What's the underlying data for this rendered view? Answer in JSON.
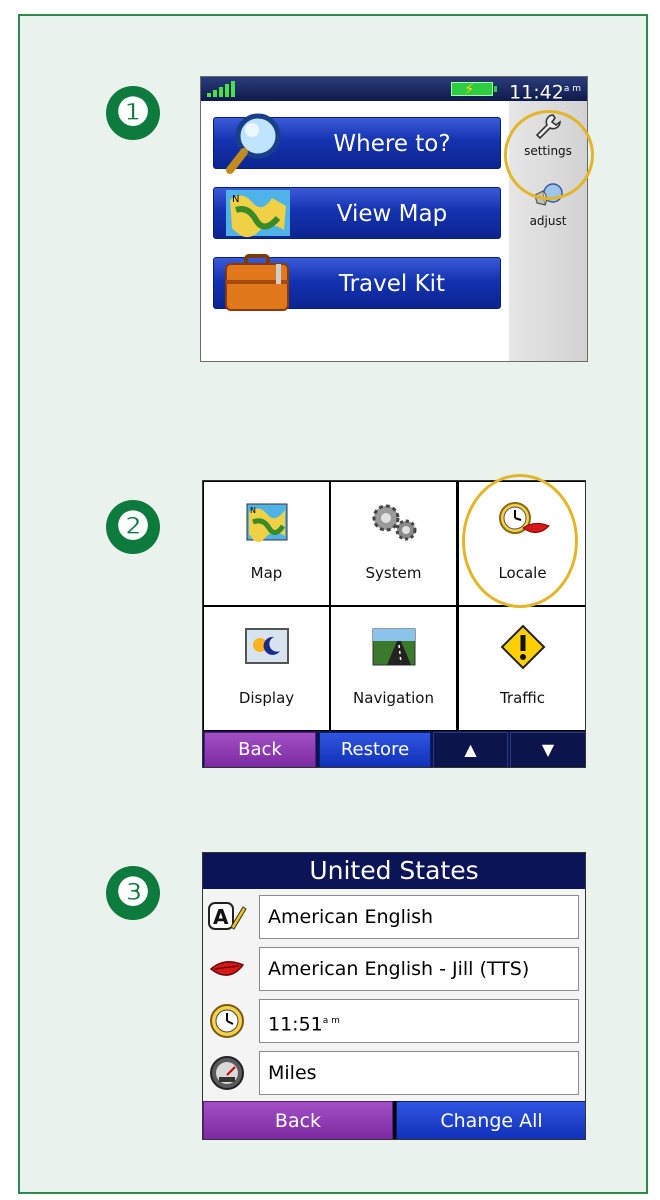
{
  "steps": [
    "❶",
    "❷",
    "❸"
  ],
  "screen1": {
    "clock": "11:42",
    "clock_ampm": "a m",
    "buttons": [
      {
        "label": "Where to?",
        "icon": "magnifier-icon"
      },
      {
        "label": "View Map",
        "icon": "map-icon"
      },
      {
        "label": "Travel Kit",
        "icon": "suitcase-icon"
      }
    ],
    "sidebar": [
      {
        "label": "settings",
        "icon": "wrench-icon"
      },
      {
        "label": "adjust",
        "icon": "speaker-icon"
      }
    ]
  },
  "screen2": {
    "tiles": [
      {
        "label": "Map",
        "icon": "map-icon"
      },
      {
        "label": "System",
        "icon": "gears-icon"
      },
      {
        "label": "Locale",
        "icon": "clock-lips-icon"
      },
      {
        "label": "Display",
        "icon": "display-icon"
      },
      {
        "label": "Navigation",
        "icon": "road-icon"
      },
      {
        "label": "Traffic",
        "icon": "warning-icon"
      }
    ],
    "back": "Back",
    "restore": "Restore",
    "up": "▲",
    "down": "▼"
  },
  "screen3": {
    "title": "United States",
    "rows": [
      {
        "value": "American English",
        "icon": "text-language-icon"
      },
      {
        "value": "American English - Jill (TTS)",
        "icon": "voice-lips-icon"
      },
      {
        "value": "11:51",
        "suffix": "a m",
        "icon": "clock-icon"
      },
      {
        "value": "Miles",
        "icon": "speedometer-icon"
      }
    ],
    "back": "Back",
    "change_all": "Change All"
  },
  "colors": {
    "panel_bg": "#e9f3ec",
    "panel_border": "#2d8a4f",
    "step_green": "#0d7a3e",
    "highlight_ring": "#e2b52b",
    "button_blue": "#1433b0",
    "button_purple": "#8a36b0"
  }
}
